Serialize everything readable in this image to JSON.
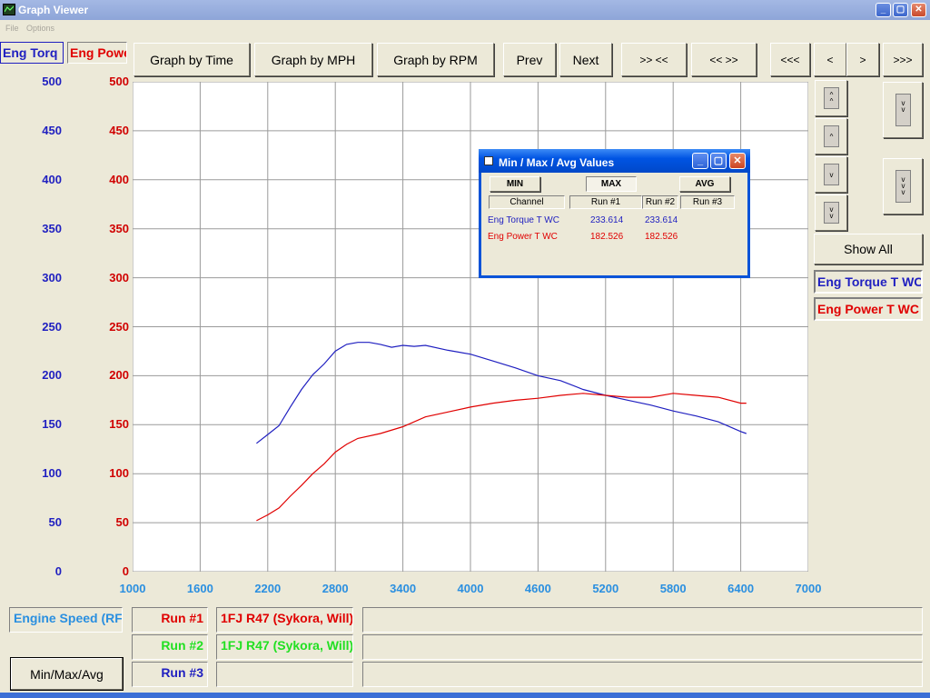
{
  "window": {
    "title": "Graph Viewer"
  },
  "menu": [
    "File",
    "Options"
  ],
  "channel_tabs": [
    "Eng Torq",
    "Eng Powe"
  ],
  "toolbar": {
    "graph_by_time": "Graph by Time",
    "graph_by_mph": "Graph by MPH",
    "graph_by_rpm": "Graph by RPM",
    "prev": "Prev",
    "next": "Next",
    "zoom_in": ">> <<",
    "zoom_out": "<< >>",
    "far_left": "<<<",
    "left": "<",
    "right": ">",
    "far_right": ">>>"
  },
  "side": {
    "show_all": "Show All",
    "legend": [
      "Eng Torque T WC",
      "Eng Power T WC"
    ]
  },
  "bottom": {
    "x_channel": "Engine Speed (RF",
    "runs": [
      {
        "label": "Run #1",
        "name": "1FJ R47 (Sykora, Will)",
        "color": "#e00000"
      },
      {
        "label": "Run #2",
        "name": "1FJ R47 (Sykora, Will)",
        "color": "#22e022"
      },
      {
        "label": "Run #3",
        "name": "",
        "color": "#1f1fc0"
      }
    ],
    "minmax_button": "Min/Max/Avg"
  },
  "dialog": {
    "title": "Min / Max / Avg Values",
    "buttons": [
      "MIN",
      "MAX",
      "AVG"
    ],
    "headers": [
      "Channel",
      "Run #1",
      "Run #2",
      "Run #3"
    ],
    "rows": [
      {
        "channel": "Eng Torque T WC",
        "run1": "233.614",
        "run2": "233.614",
        "run3": "",
        "color": "#1f1fc0"
      },
      {
        "channel": "Eng Power T WC",
        "run1": "182.526",
        "run2": "182.526",
        "run3": "",
        "color": "#e00000"
      }
    ]
  },
  "colors": {
    "torque": "#1f1fc0",
    "power": "#e00000",
    "xaxis": "#2a8fe0",
    "accent": "#0054e3"
  },
  "chart_data": {
    "type": "line",
    "xlim": [
      1000,
      7000
    ],
    "ylim": [
      0,
      500
    ],
    "x_ticks": [
      "1000",
      "1600",
      "2200",
      "2800",
      "3400",
      "4000",
      "4600",
      "5200",
      "5800",
      "6400",
      "7000"
    ],
    "y_ticks": [
      "0",
      "50",
      "100",
      "150",
      "200",
      "250",
      "300",
      "350",
      "400",
      "450",
      "500"
    ],
    "grid": true,
    "series": [
      {
        "name": "Eng Torque T WC",
        "color": "#1f1fc0",
        "x": [
          2100,
          2200,
          2300,
          2400,
          2500,
          2600,
          2700,
          2800,
          2900,
          3000,
          3100,
          3200,
          3300,
          3400,
          3500,
          3600,
          3800,
          4000,
          4200,
          4400,
          4600,
          4800,
          5000,
          5200,
          5400,
          5600,
          5800,
          6000,
          6200,
          6400,
          6450
        ],
        "y": [
          131,
          140,
          149,
          168,
          186,
          201,
          212,
          225,
          232,
          234,
          234,
          232,
          229,
          231,
          230,
          231,
          226,
          222,
          215,
          208,
          200,
          195,
          186,
          180,
          175,
          170,
          164,
          159,
          153,
          143,
          141
        ]
      },
      {
        "name": "Eng Power T WC",
        "color": "#e00000",
        "x": [
          2100,
          2200,
          2300,
          2400,
          2500,
          2600,
          2700,
          2800,
          2900,
          3000,
          3200,
          3400,
          3600,
          3800,
          4000,
          4200,
          4400,
          4600,
          4800,
          5000,
          5200,
          5400,
          5600,
          5800,
          6000,
          6200,
          6400,
          6450
        ],
        "y": [
          52,
          58,
          65,
          77,
          88,
          100,
          110,
          122,
          130,
          136,
          141,
          148,
          158,
          163,
          168,
          172,
          175,
          177,
          180,
          182,
          180,
          178,
          178,
          182,
          180,
          178,
          172,
          172
        ]
      }
    ]
  }
}
